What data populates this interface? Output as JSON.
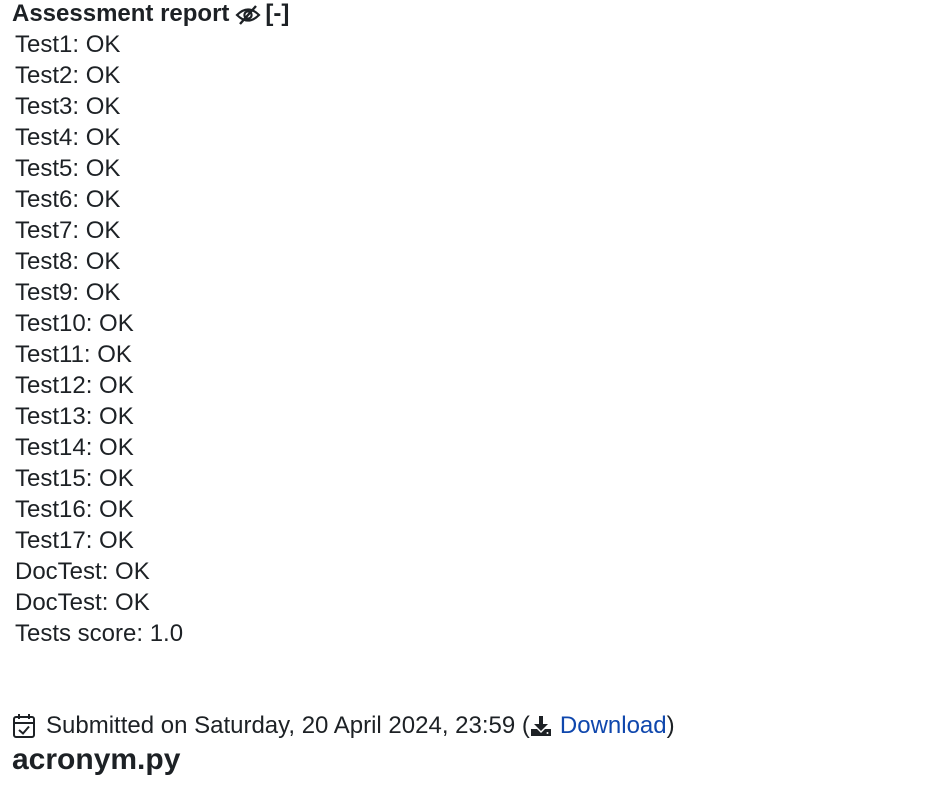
{
  "report": {
    "title": "Assessment report",
    "toggle_label": "[-]",
    "icon": "eye-slash-icon",
    "tests": [
      {
        "label": "Test1: OK"
      },
      {
        "label": "Test2: OK"
      },
      {
        "label": "Test3: OK"
      },
      {
        "label": "Test4: OK"
      },
      {
        "label": "Test5: OK"
      },
      {
        "label": "Test6: OK"
      },
      {
        "label": "Test7: OK"
      },
      {
        "label": "Test8: OK"
      },
      {
        "label": "Test9: OK"
      },
      {
        "label": "Test10: OK"
      },
      {
        "label": "Test11: OK"
      },
      {
        "label": "Test12: OK"
      },
      {
        "label": "Test13: OK"
      },
      {
        "label": "Test14: OK"
      },
      {
        "label": "Test15: OK"
      },
      {
        "label": "Test16: OK"
      },
      {
        "label": "Test17: OK"
      },
      {
        "label": "DocTest: OK"
      },
      {
        "label": "DocTest: OK"
      },
      {
        "label": "Tests score: 1.0"
      }
    ]
  },
  "submission": {
    "icon": "calendar-check-icon",
    "text": "Submitted on Saturday, 20 April 2024, 23:59",
    "open_paren": " (",
    "download_icon": "download-icon",
    "download_label": "Download",
    "close_paren": ")",
    "link_color": "#0f47ad"
  },
  "file": {
    "name": "acronym.py"
  }
}
